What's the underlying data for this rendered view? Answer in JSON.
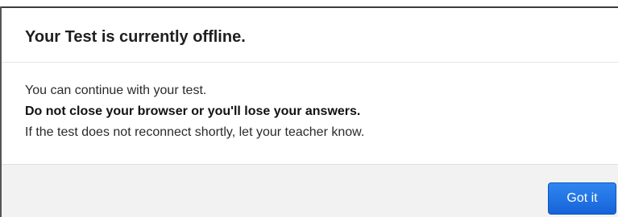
{
  "dialog": {
    "title": "Your Test is currently offline.",
    "body": {
      "line1": "You can continue with your test.",
      "line2": "Do not close your browser or you'll lose your answers.",
      "line3": "If the test does not reconnect shortly, let your teacher know."
    },
    "footer": {
      "confirm_label": "Got it"
    }
  },
  "colors": {
    "button_blue": "#1f73e6",
    "footer_bg": "#f2f2f2",
    "title_text": "#1f1f1f"
  }
}
